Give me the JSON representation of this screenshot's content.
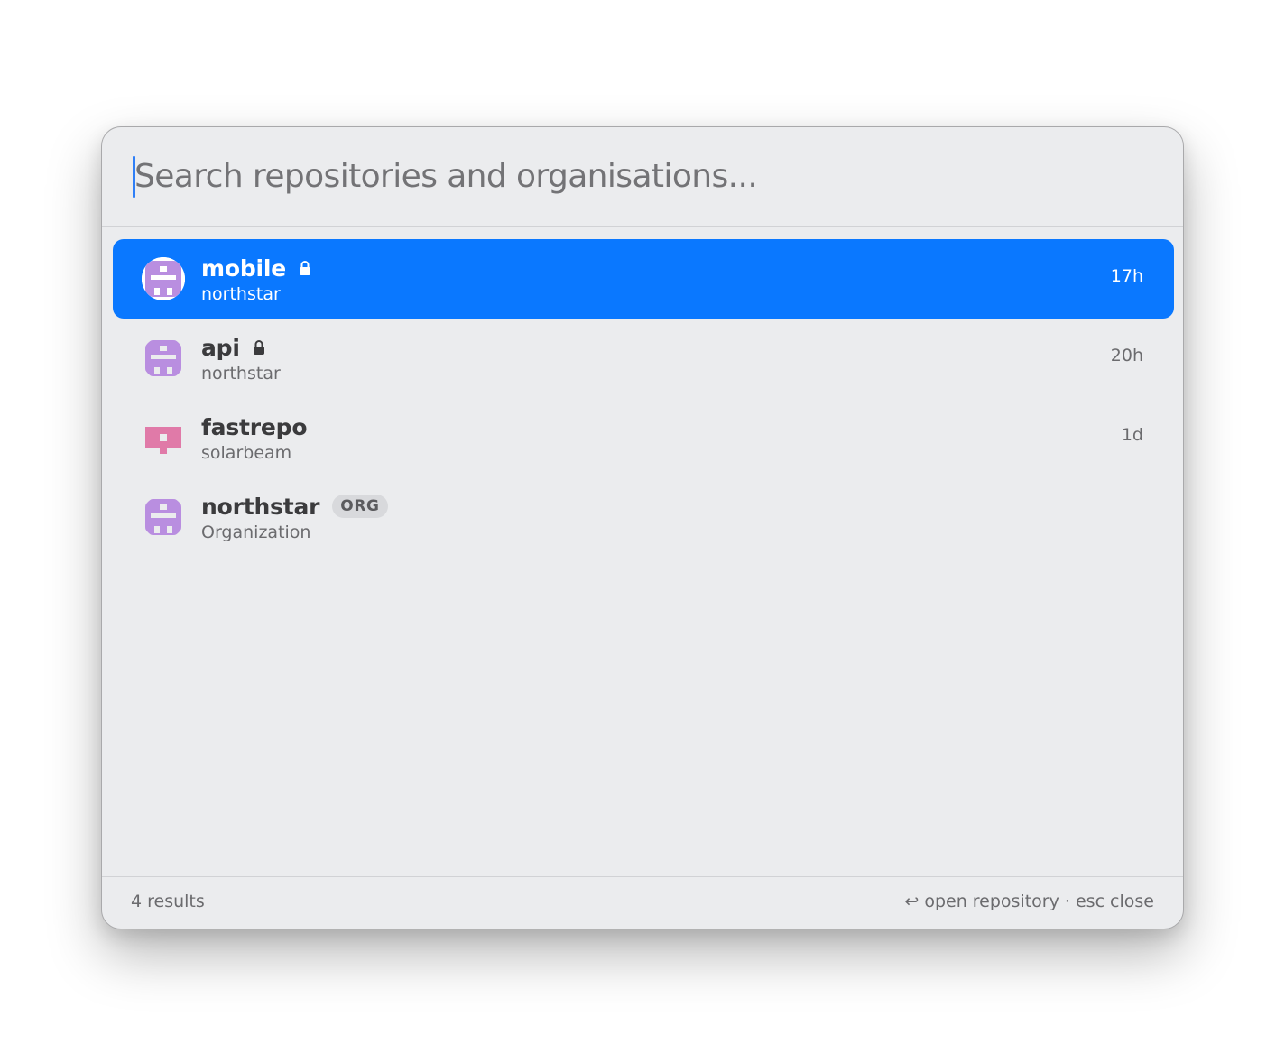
{
  "search": {
    "placeholder": "Search repositories and organisations...",
    "value": ""
  },
  "results": [
    {
      "name": "mobile",
      "owner": "northstar",
      "time": "17h",
      "private": true,
      "selected": true,
      "avatar": "northstar-identicon"
    },
    {
      "name": "api",
      "owner": "northstar",
      "time": "20h",
      "private": true,
      "selected": false,
      "avatar": "northstar-identicon"
    },
    {
      "name": "fastrepo",
      "owner": "solarbeam",
      "time": "1d",
      "private": false,
      "selected": false,
      "avatar": "solarbeam-identicon"
    },
    {
      "name": "northstar",
      "badge": "ORG",
      "subtitle": "Organization",
      "selected": false,
      "avatar": "northstar-identicon"
    }
  ],
  "footer": {
    "count": "4 results",
    "enter_icon": "↩",
    "hint": "open repository · esc close"
  },
  "colors": {
    "selection": "#0a78ff",
    "northstar_avatar": "#b98ee0",
    "solarbeam_avatar": "#e07aa8",
    "caret": "#2f7ff7"
  }
}
